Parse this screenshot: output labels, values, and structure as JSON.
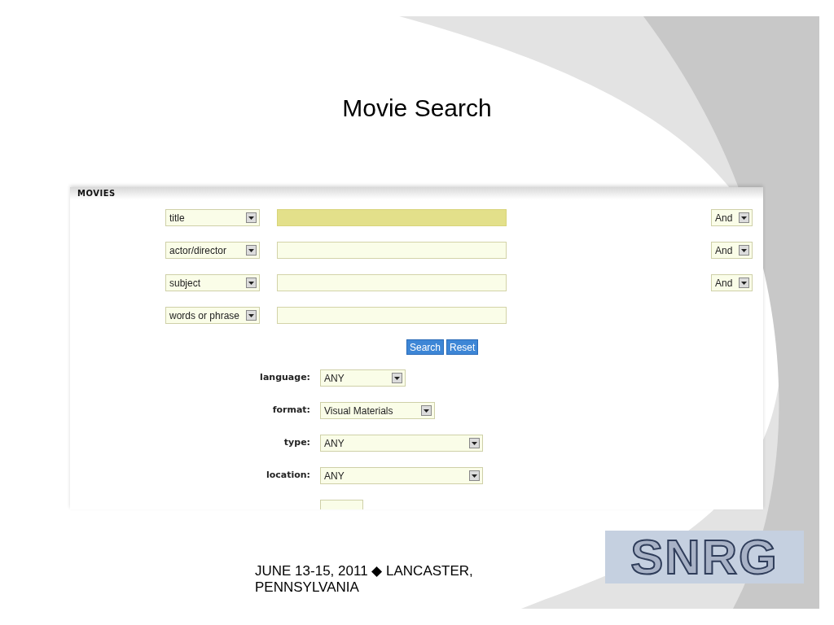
{
  "slide": {
    "title": "Movie Search"
  },
  "panel": {
    "heading": "MOVIES",
    "criteria": [
      {
        "field": "title",
        "operator": "And",
        "focused": true
      },
      {
        "field": "actor/director",
        "operator": "And",
        "focused": false
      },
      {
        "field": "subject",
        "operator": "And",
        "focused": false
      },
      {
        "field": "words or phrase",
        "focused": false
      }
    ],
    "buttons": [
      {
        "label": "Search"
      },
      {
        "label": "Reset"
      }
    ],
    "filters": [
      {
        "label": "language:",
        "value": "ANY",
        "kind": "short"
      },
      {
        "label": "format:",
        "value": "Visual Materials",
        "kind": "medium"
      },
      {
        "label": "type:",
        "value": "ANY",
        "kind": "long"
      },
      {
        "label": "location:",
        "value": "ANY",
        "kind": "long"
      }
    ]
  },
  "footer": {
    "text": "JUNE 13-15, 2011 ◆ LANCASTER, PENNSYLVANIA"
  },
  "logo": {
    "text": "SNRG"
  }
}
